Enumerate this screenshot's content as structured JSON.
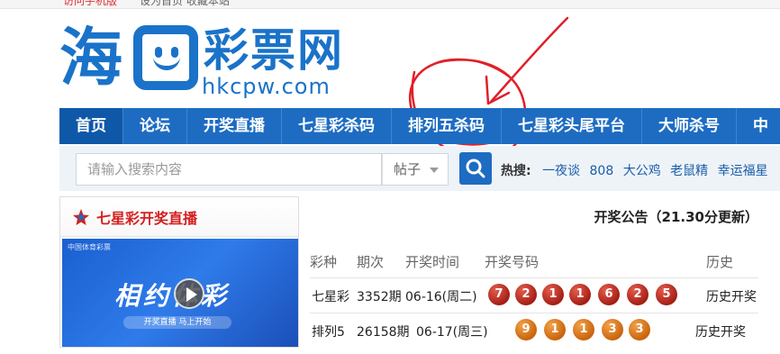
{
  "topbar": {
    "left_text": "访问手机版",
    "right_text": "设为首页  收藏本站"
  },
  "logo": {
    "hai_char": "海",
    "rest_chars": "彩票网",
    "domain": "hkcpw.com"
  },
  "nav": {
    "items": [
      "首页",
      "论坛",
      "开奖直播",
      "七星彩杀码",
      "排列五杀码",
      "七星彩头尾平台",
      "大师杀号",
      "中"
    ]
  },
  "search": {
    "placeholder": "请输入搜索内容",
    "type_label": "帖子",
    "hot_label": "热搜:",
    "hot_keywords": [
      "一夜谈",
      "808",
      "大公鸡",
      "老鼠精",
      "幸运福星"
    ]
  },
  "live": {
    "title": "七星彩开奖直播",
    "video_tag": "中国体育彩票",
    "video_big_text": "相约体彩",
    "video_bar_text": "开奖直播  马上开始"
  },
  "notice": {
    "title": "开奖公告（21.30分更新）",
    "headers": {
      "game": "彩种",
      "issue": "期次",
      "time": "开奖时间",
      "numbers": "开奖号码",
      "history": "历史"
    },
    "rows": [
      {
        "game": "七星彩",
        "issue": "3352期",
        "time": "06-16(周二)",
        "balls": [
          "7",
          "2",
          "1",
          "1",
          "6",
          "2",
          "5"
        ],
        "history": "历史开奖",
        "color": "red"
      },
      {
        "game": "排列5",
        "issue": "26158期",
        "time": "06-17(周三)",
        "balls": [
          "9",
          "1",
          "1",
          "3",
          "3"
        ],
        "history": "历史开奖",
        "color": "orange"
      }
    ]
  },
  "colors": {
    "brand_blue": "#1d6cc2",
    "annotation_red": "#e0202a",
    "live_red": "#d42020"
  }
}
